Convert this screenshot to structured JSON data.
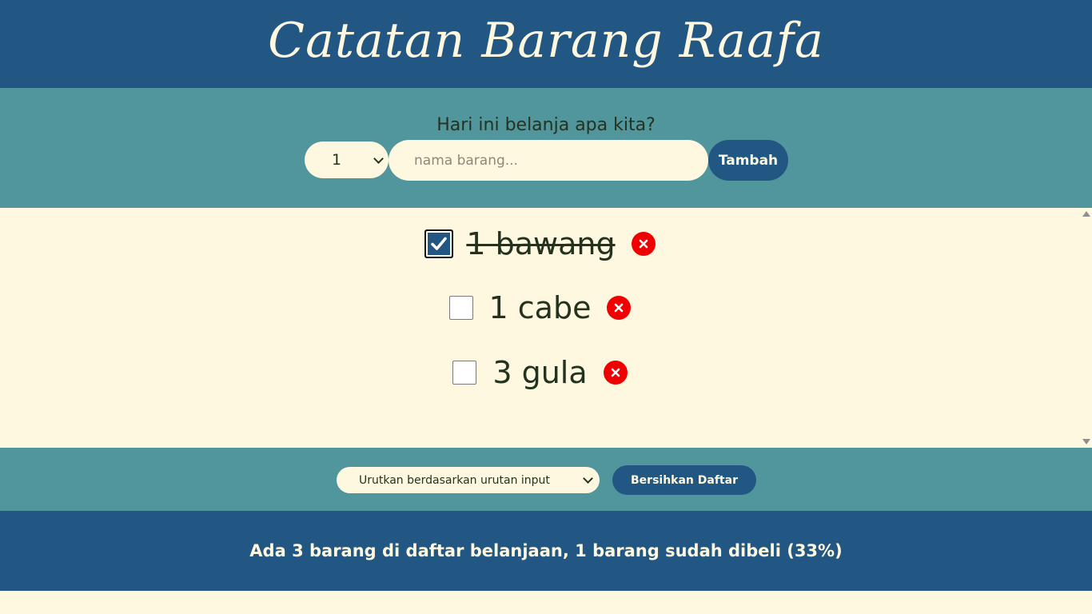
{
  "header": {
    "title": "Catatan Barang Raafa"
  },
  "form": {
    "prompt": "Hari ini belanja apa kita?",
    "quantity_selected": "1",
    "name_placeholder": "nama barang...",
    "add_label": "Tambah"
  },
  "items": [
    {
      "text": "1 bawang",
      "checked": true
    },
    {
      "text": "1 cabe",
      "checked": false
    },
    {
      "text": "3 gula",
      "checked": false
    }
  ],
  "actions": {
    "sort_selected": "Urutkan berdasarkan urutan input",
    "clear_label": "Bersihkan Daftar"
  },
  "footer": {
    "stats": "Ada 3 barang di daftar belanjaan, 1 barang sudah dibeli (33%)"
  },
  "colors": {
    "primary": "#215782",
    "secondary": "#51969c",
    "background": "#fdf8df",
    "text": "#24331f",
    "delete": "#f00000"
  }
}
